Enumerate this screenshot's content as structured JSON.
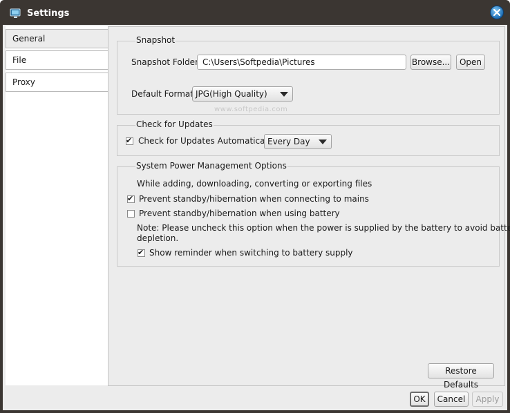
{
  "window": {
    "title": "Settings",
    "app_icon": "monitor-icon",
    "close_icon": "close-icon"
  },
  "nav": {
    "tabs": [
      {
        "label": "General",
        "active": true
      },
      {
        "label": "File",
        "active": false
      },
      {
        "label": "Proxy",
        "active": false
      }
    ]
  },
  "snapshot": {
    "legend": "Snapshot",
    "folder_label": "Snapshot Folder:",
    "folder_value": "C:\\Users\\Softpedia\\Pictures",
    "browse_label": "Browse...",
    "open_label": "Open",
    "format_label": "Default Format:",
    "format_value": "JPG(High Quality)"
  },
  "watermark": "www.softpedia.com",
  "updates": {
    "legend": "Check for Updates",
    "auto_label": "Check for Updates Automatically:",
    "auto_checked": true,
    "frequency_value": "Every Day"
  },
  "power": {
    "legend": "System Power Management Options",
    "intro": "While adding, downloading, converting or exporting files",
    "mains_label": "Prevent standby/hibernation when connecting to mains",
    "mains_checked": true,
    "battery_label": "Prevent standby/hibernation when using battery",
    "battery_checked": false,
    "note_line1": "Note: Please uncheck this option when the power is supplied by the battery to avoid battery",
    "note_line2": "depletion.",
    "reminder_label": "Show reminder when switching to battery supply",
    "reminder_checked": true
  },
  "footer": {
    "restore_label": "Restore Defaults",
    "ok_label": "OK",
    "cancel_label": "Cancel",
    "apply_label": "Apply"
  }
}
